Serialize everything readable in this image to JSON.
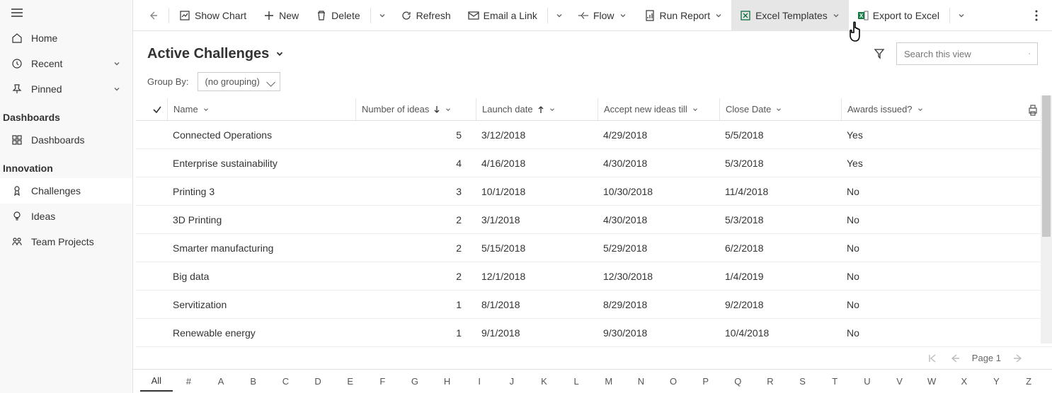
{
  "sidebar": {
    "home": "Home",
    "recent": "Recent",
    "pinned": "Pinned",
    "sections": {
      "dashboards": {
        "label": "Dashboards",
        "items": [
          "Dashboards"
        ]
      },
      "innovation": {
        "label": "Innovation",
        "items": [
          "Challenges",
          "Ideas",
          "Team Projects"
        ]
      }
    }
  },
  "cmdbar": {
    "showChart": "Show Chart",
    "new": "New",
    "delete": "Delete",
    "refresh": "Refresh",
    "emailLink": "Email a Link",
    "flow": "Flow",
    "runReport": "Run Report",
    "excelTemplates": "Excel Templates",
    "exportExcel": "Export to Excel"
  },
  "view": {
    "title": "Active Challenges",
    "groupByLabel": "Group By:",
    "groupByValue": "(no grouping)",
    "searchPlaceholder": "Search this view"
  },
  "columns": {
    "name": "Name",
    "num": "Number of ideas",
    "launch": "Launch date",
    "accept": "Accept new ideas till",
    "close": "Close Date",
    "awards": "Awards issued?"
  },
  "rows": [
    {
      "name": "Connected Operations",
      "num": "5",
      "launch": "3/12/2018",
      "accept": "4/29/2018",
      "close": "5/5/2018",
      "awards": "Yes"
    },
    {
      "name": "Enterprise sustainability",
      "num": "4",
      "launch": "4/16/2018",
      "accept": "4/30/2018",
      "close": "5/3/2018",
      "awards": "Yes"
    },
    {
      "name": "Printing 3",
      "num": "3",
      "launch": "10/1/2018",
      "accept": "10/30/2018",
      "close": "11/4/2018",
      "awards": "No"
    },
    {
      "name": "3D Printing",
      "num": "2",
      "launch": "3/1/2018",
      "accept": "4/30/2018",
      "close": "5/3/2018",
      "awards": "No"
    },
    {
      "name": "Smarter manufacturing",
      "num": "2",
      "launch": "5/15/2018",
      "accept": "5/29/2018",
      "close": "6/2/2018",
      "awards": "No"
    },
    {
      "name": "Big data",
      "num": "2",
      "launch": "12/1/2018",
      "accept": "12/30/2018",
      "close": "1/4/2019",
      "awards": "No"
    },
    {
      "name": "Servitization",
      "num": "1",
      "launch": "8/1/2018",
      "accept": "8/29/2018",
      "close": "9/2/2018",
      "awards": "No"
    },
    {
      "name": "Renewable energy",
      "num": "1",
      "launch": "9/1/2018",
      "accept": "9/30/2018",
      "close": "10/4/2018",
      "awards": "No"
    }
  ],
  "pager": {
    "page": "Page 1"
  },
  "alpha": [
    "All",
    "#",
    "A",
    "B",
    "C",
    "D",
    "E",
    "F",
    "G",
    "H",
    "I",
    "J",
    "K",
    "L",
    "M",
    "N",
    "O",
    "P",
    "Q",
    "R",
    "S",
    "T",
    "U",
    "V",
    "W",
    "X",
    "Y",
    "Z"
  ]
}
